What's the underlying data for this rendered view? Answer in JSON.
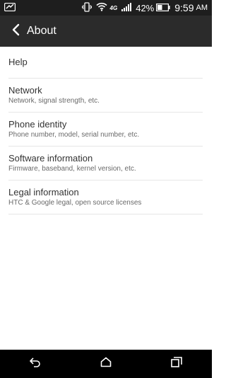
{
  "status_bar": {
    "network_type": "4G",
    "battery_percent": "42%",
    "time": "9:59",
    "time_suffix": "AM",
    "icons": [
      "wallet-icon",
      "vibrate-icon",
      "wifi-icon",
      "signal-icon",
      "battery-icon"
    ]
  },
  "header": {
    "title": "About",
    "back_icon": "back-arrow-icon"
  },
  "items": [
    {
      "title": "Help",
      "subtitle": ""
    },
    {
      "title": "Network",
      "subtitle": "Network, signal strength, etc."
    },
    {
      "title": "Phone identity",
      "subtitle": "Phone number, model, serial number, etc."
    },
    {
      "title": "Software information",
      "subtitle": "Firmware, baseband, kernel version, etc."
    },
    {
      "title": "Legal information",
      "subtitle": "HTC & Google legal, open source licenses"
    }
  ],
  "nav_bar": {
    "icons": [
      "back-icon",
      "home-icon",
      "recent-apps-icon"
    ]
  },
  "colors": {
    "status_bar": "#1e1e1e",
    "action_bar": "#2b2b2b",
    "nav_bar": "#000000",
    "divider": "#e6e6e6"
  }
}
